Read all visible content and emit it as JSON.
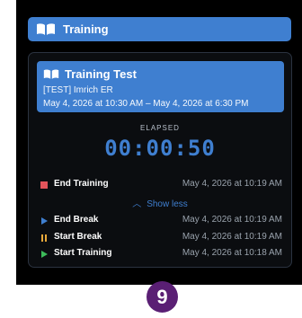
{
  "header": {
    "title": "Training",
    "icon": "book-open-icon"
  },
  "test": {
    "title": "Training Test",
    "subtitle": "[TEST] Imrich ER",
    "dates": "May 4, 2026 at 10:30 AM – May 4, 2026 at 6:30 PM",
    "icon": "book-open-icon"
  },
  "timer": {
    "label": "ELAPSED",
    "value": "00:00:50"
  },
  "actions": {
    "end_training": {
      "label": "End Training",
      "time": "May 4, 2026 at 10:19 AM",
      "icon": "stop-square-icon",
      "color": "#e2545b"
    },
    "show_less": {
      "label": "Show less",
      "icon": "chevron-up-icon"
    }
  },
  "history": [
    {
      "label": "End Break",
      "time": "May 4, 2026 at 10:19 AM",
      "icon": "play-triangle-icon",
      "color": "#3f7fd0"
    },
    {
      "label": "Start Break",
      "time": "May 4, 2026 at 10:19 AM",
      "icon": "pause-icon",
      "color": "#e8a93a"
    },
    {
      "label": "Start Training",
      "time": "May 4, 2026 at 10:18 AM",
      "icon": "play-triangle-icon",
      "color": "#3dbb5a"
    }
  ],
  "badge": {
    "value": "9",
    "color": "#5a1f74"
  }
}
